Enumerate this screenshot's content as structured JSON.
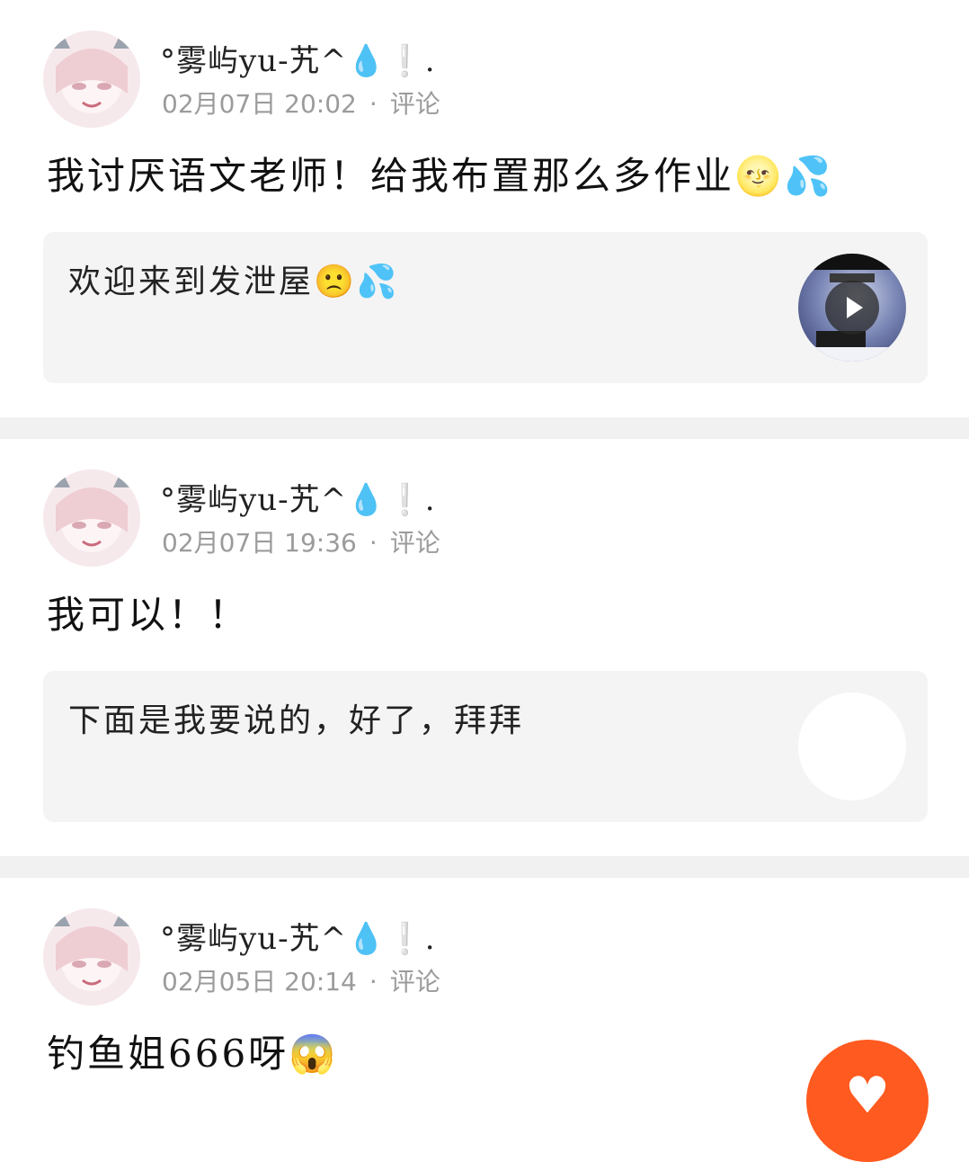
{
  "posts": [
    {
      "username": "°雾屿yu-艽^💧❕.",
      "date": "02月07日 20:02",
      "separator": "·",
      "comment_label": "评论",
      "content": "我讨厌语文老师！给我布置那么多作业🌝💦",
      "quote_text": "欢迎来到发泄屋🙁💦",
      "thumb_type": "video"
    },
    {
      "username": "°雾屿yu-艽^💧❕.",
      "date": "02月07日 19:36",
      "separator": "·",
      "comment_label": "评论",
      "content": "我可以！！",
      "quote_text": "下面是我要说的，好了，拜拜",
      "thumb_type": "blank"
    },
    {
      "username": "°雾屿yu-艽^💧❕.",
      "date": "02月05日 20:14",
      "separator": "·",
      "comment_label": "评论",
      "content": "钓鱼姐666呀😱"
    }
  ],
  "floating_button": {
    "icon": "heart-icon",
    "glyph": "♥",
    "color": "#ff5a1f"
  }
}
